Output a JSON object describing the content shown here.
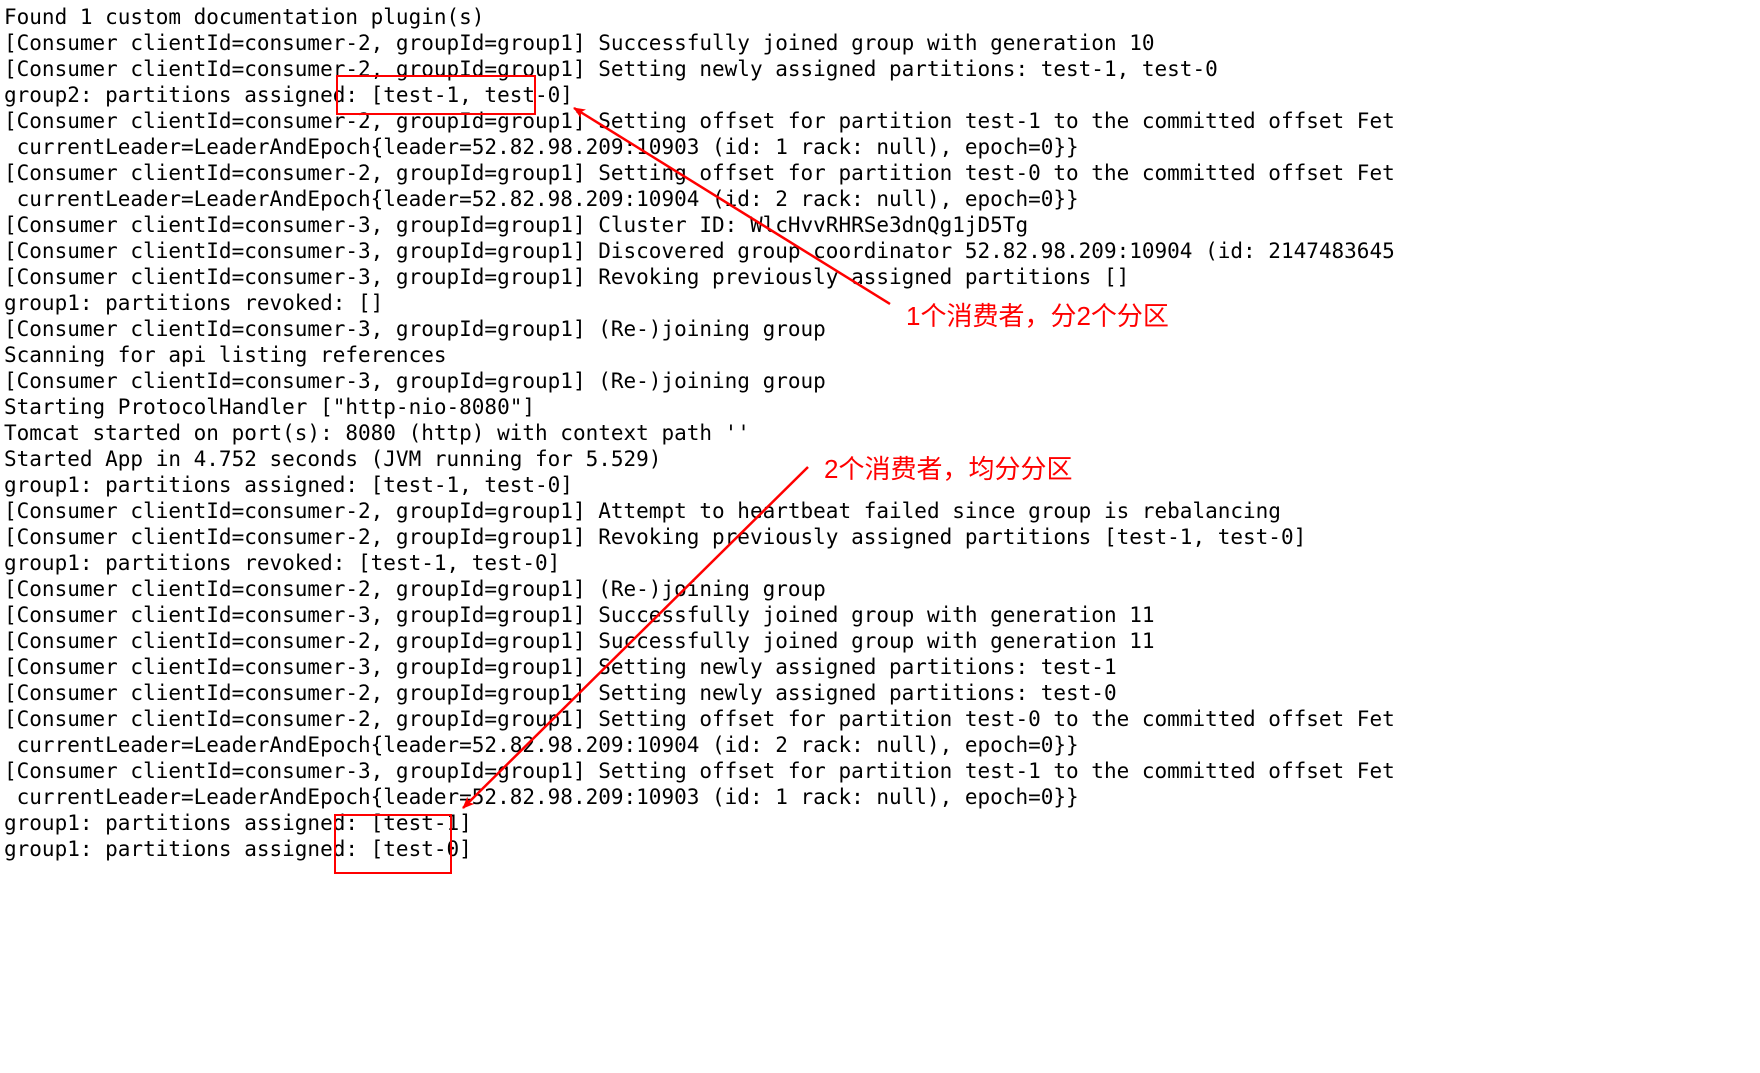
{
  "log": {
    "lines": [
      "Found 1 custom documentation plugin(s)",
      "[Consumer clientId=consumer-2, groupId=group1] Successfully joined group with generation 10",
      "[Consumer clientId=consumer-2, groupId=group1] Setting newly assigned partitions: test-1, test-0",
      "group2: partitions assigned: [test-1, test-0]",
      "[Consumer clientId=consumer-2, groupId=group1] Setting offset for partition test-1 to the committed offset Fet",
      " currentLeader=LeaderAndEpoch{leader=52.82.98.209:10903 (id: 1 rack: null), epoch=0}}",
      "[Consumer clientId=consumer-2, groupId=group1] Setting offset for partition test-0 to the committed offset Fet",
      " currentLeader=LeaderAndEpoch{leader=52.82.98.209:10904 (id: 2 rack: null), epoch=0}}",
      "[Consumer clientId=consumer-3, groupId=group1] Cluster ID: WlcHvvRHRSe3dnQg1jD5Tg",
      "[Consumer clientId=consumer-3, groupId=group1] Discovered group coordinator 52.82.98.209:10904 (id: 2147483645",
      "[Consumer clientId=consumer-3, groupId=group1] Revoking previously assigned partitions []",
      "group1: partitions revoked: []",
      "[Consumer clientId=consumer-3, groupId=group1] (Re-)joining group",
      "Scanning for api listing references",
      "[Consumer clientId=consumer-3, groupId=group1] (Re-)joining group",
      "Starting ProtocolHandler [\"http-nio-8080\"]",
      "Tomcat started on port(s): 8080 (http) with context path ''",
      "Started App in 4.752 seconds (JVM running for 5.529)",
      "group1: partitions assigned: [test-1, test-0]",
      "[Consumer clientId=consumer-2, groupId=group1] Attempt to heartbeat failed since group is rebalancing",
      "[Consumer clientId=consumer-2, groupId=group1] Revoking previously assigned partitions [test-1, test-0]",
      "group1: partitions revoked: [test-1, test-0]",
      "[Consumer clientId=consumer-2, groupId=group1] (Re-)joining group",
      "[Consumer clientId=consumer-3, groupId=group1] Successfully joined group with generation 11",
      "[Consumer clientId=consumer-2, groupId=group1] Successfully joined group with generation 11",
      "[Consumer clientId=consumer-3, groupId=group1] Setting newly assigned partitions: test-1",
      "[Consumer clientId=consumer-2, groupId=group1] Setting newly assigned partitions: test-0",
      "[Consumer clientId=consumer-2, groupId=group1] Setting offset for partition test-0 to the committed offset Fet",
      " currentLeader=LeaderAndEpoch{leader=52.82.98.209:10904 (id: 2 rack: null), epoch=0}}",
      "[Consumer clientId=consumer-3, groupId=group1] Setting offset for partition test-1 to the committed offset Fet",
      " currentLeader=LeaderAndEpoch{leader=52.82.98.209:10903 (id: 1 rack: null), epoch=0}}",
      "group1: partitions assigned: [test-1]",
      "group1: partitions assigned: [test-0]"
    ]
  },
  "annotations": {
    "a1": "1个消费者，分2个分区",
    "a2": "2个消费者，均分分区"
  },
  "colors": {
    "red": "#ff0000"
  }
}
